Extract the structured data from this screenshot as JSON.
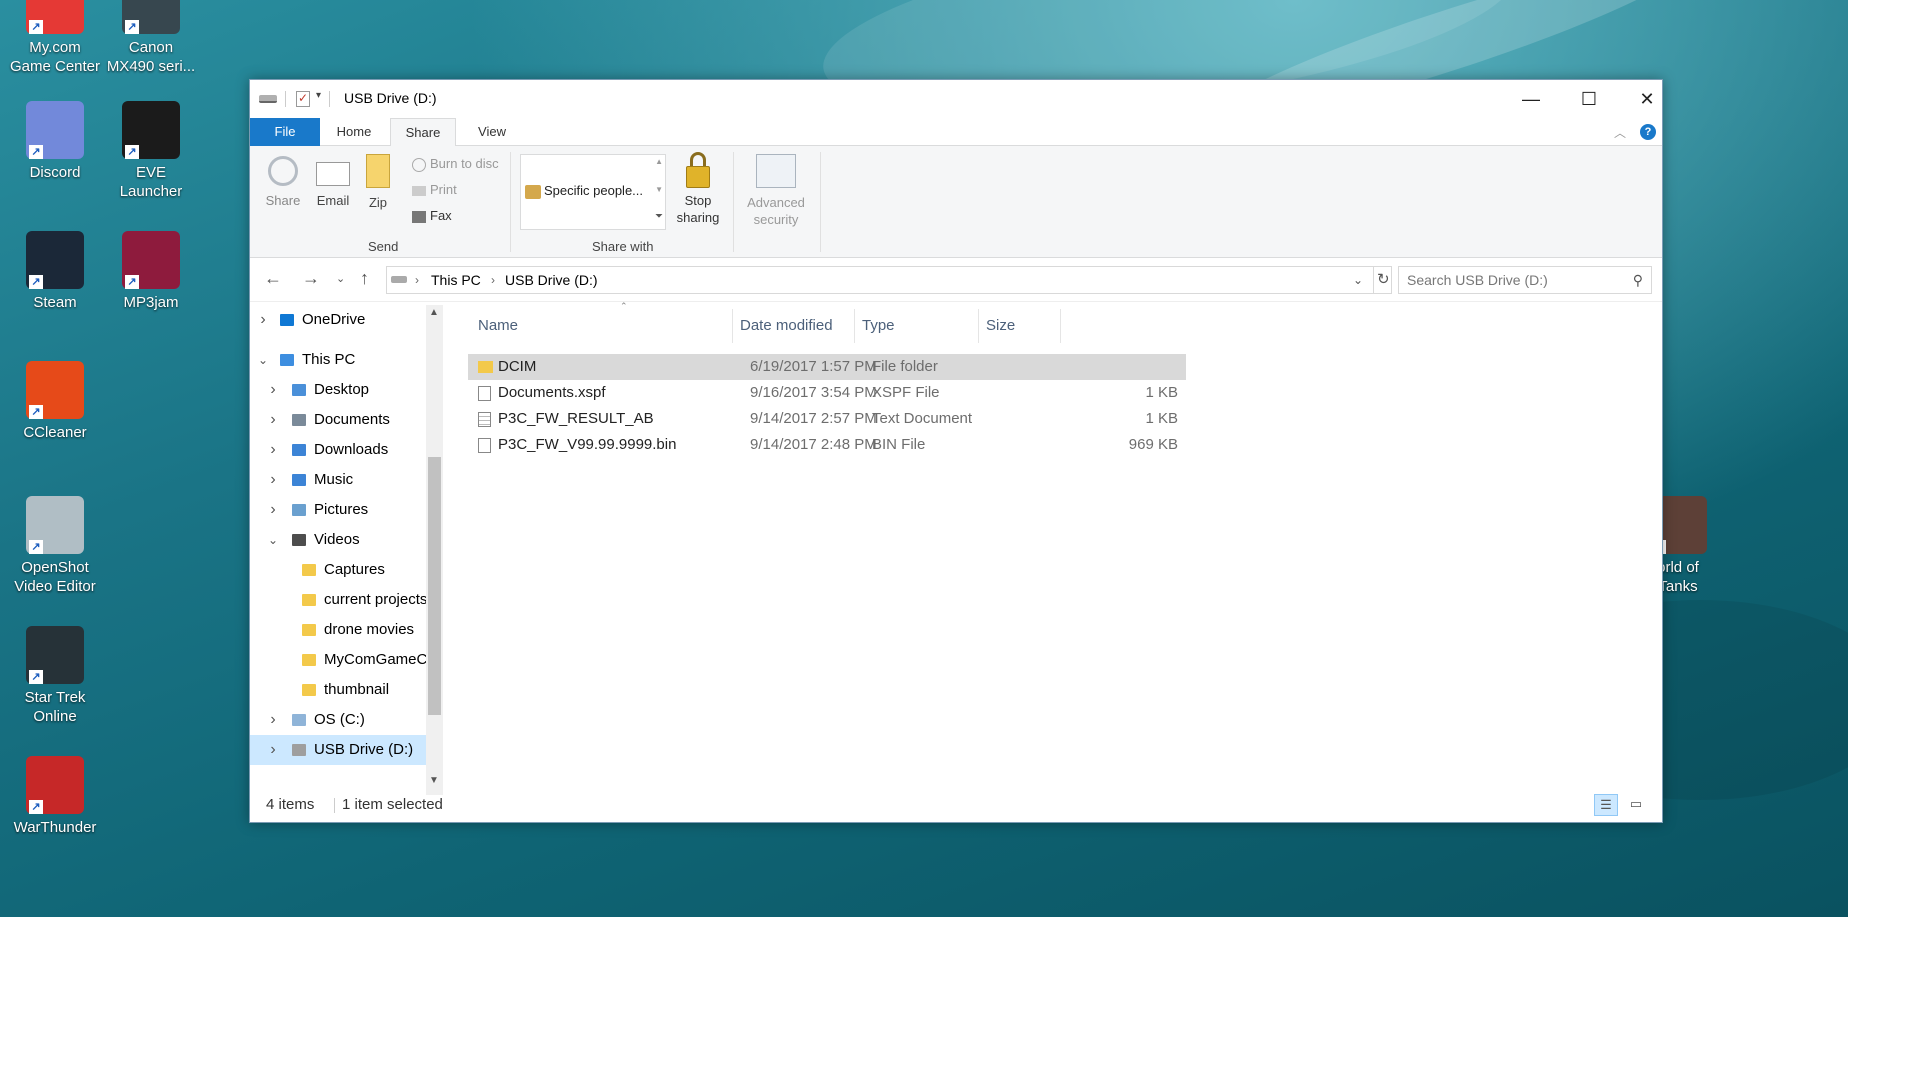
{
  "desktop": {
    "icons": [
      {
        "label": "My.com\nGame Center",
        "icon": "mycom-icon",
        "color": "#e53935"
      },
      {
        "label": "Canon\nMX490 seri...",
        "icon": "printer-icon",
        "color": "#37474f"
      },
      {
        "label": "Discord",
        "icon": "discord-icon",
        "color": "#7289da"
      },
      {
        "label": "EVE Launcher",
        "icon": "eve-icon",
        "color": "#1b1b1b"
      },
      {
        "label": "Steam",
        "icon": "steam-icon",
        "color": "#1b2838"
      },
      {
        "label": "MP3jam",
        "icon": "mp3jam-icon",
        "color": "#8e1b3d"
      },
      {
        "label": "CCleaner",
        "icon": "ccleaner-icon",
        "color": "#e64a19"
      },
      {
        "label": "OpenShot\nVideo Editor",
        "icon": "openshot-icon",
        "color": "#b0bec5"
      },
      {
        "label": "Star Trek\nOnline",
        "icon": "startrek-icon",
        "color": "#263238"
      },
      {
        "label": "WarThunder",
        "icon": "warthunder-icon",
        "color": "#c62828"
      },
      {
        "label": "orld of\nTanks",
        "icon": "worldoftanks-icon",
        "color": "#5d4037"
      }
    ]
  },
  "window": {
    "title": "USB Drive (D:)",
    "controls": {
      "minimize": "—",
      "maximize": "☐",
      "close": "✕"
    },
    "tabs": [
      "File",
      "Home",
      "Share",
      "View"
    ],
    "active_tab": "Share",
    "help": "?",
    "ribbon": {
      "send": {
        "share": "Share",
        "email": "Email",
        "zip": "Zip",
        "burn": "Burn to disc",
        "print": "Print",
        "fax": "Fax",
        "group_label": "Send"
      },
      "share_with": {
        "item": "Specific people...",
        "group_label": "Share with"
      },
      "stop_sharing": "Stop\nsharing",
      "advanced_security": "Advanced\nsecurity"
    },
    "address": {
      "crumbs": [
        "This PC",
        "USB Drive (D:)"
      ],
      "search_placeholder": "Search USB Drive (D:)"
    },
    "nav": [
      {
        "label": "OneDrive",
        "level": 0,
        "expand": "collapsed",
        "icon": "onedrive-icon",
        "color": "#0f78d4"
      },
      {
        "label": "This PC",
        "level": 0,
        "expand": "expanded",
        "icon": "pc-icon",
        "color": "#3d8ee0"
      },
      {
        "label": "Desktop",
        "level": 1,
        "expand": "collapsed",
        "icon": "desktop-folder-icon",
        "color": "#4a90d9"
      },
      {
        "label": "Documents",
        "level": 1,
        "expand": "collapsed",
        "icon": "documents-folder-icon",
        "color": "#7a8a99"
      },
      {
        "label": "Downloads",
        "level": 1,
        "expand": "collapsed",
        "icon": "downloads-folder-icon",
        "color": "#3c84d6"
      },
      {
        "label": "Music",
        "level": 1,
        "expand": "collapsed",
        "icon": "music-folder-icon",
        "color": "#3c84d6"
      },
      {
        "label": "Pictures",
        "level": 1,
        "expand": "collapsed",
        "icon": "pictures-folder-icon",
        "color": "#6aa0cf"
      },
      {
        "label": "Videos",
        "level": 1,
        "expand": "expanded",
        "icon": "videos-folder-icon",
        "color": "#4d4d4d"
      },
      {
        "label": "Captures",
        "level": 2,
        "expand": "none",
        "icon": "folder-icon",
        "color": "#f3c94a"
      },
      {
        "label": "current projects",
        "level": 2,
        "expand": "none",
        "icon": "folder-icon",
        "color": "#f3c94a"
      },
      {
        "label": "drone movies",
        "level": 2,
        "expand": "none",
        "icon": "folder-icon",
        "color": "#f3c94a"
      },
      {
        "label": "MyComGameCenter",
        "level": 2,
        "expand": "none",
        "icon": "folder-icon",
        "color": "#f3c94a"
      },
      {
        "label": "thumbnail",
        "level": 2,
        "expand": "none",
        "icon": "folder-icon",
        "color": "#f3c94a"
      },
      {
        "label": "OS (C:)",
        "level": 1,
        "expand": "collapsed",
        "icon": "drive-c-icon",
        "color": "#8fb4d8"
      },
      {
        "label": "USB Drive (D:)",
        "level": 1,
        "expand": "collapsed",
        "icon": "usb-drive-icon",
        "color": "#9e9e9e",
        "selected": true
      }
    ],
    "columns": [
      "Name",
      "Date modified",
      "Type",
      "Size"
    ],
    "files": [
      {
        "name": "DCIM",
        "date": "6/19/2017 1:57 PM",
        "type": "File folder",
        "size": "",
        "kind": "folder",
        "selected": true
      },
      {
        "name": "Documents.xspf",
        "date": "9/16/2017 3:54 PM",
        "type": "XSPF File",
        "size": "1 KB",
        "kind": "file"
      },
      {
        "name": "P3C_FW_RESULT_AB",
        "date": "9/14/2017 2:57 PM",
        "type": "Text Document",
        "size": "1 KB",
        "kind": "text"
      },
      {
        "name": "P3C_FW_V99.99.9999.bin",
        "date": "9/14/2017 2:48 PM",
        "type": "BIN File",
        "size": "969 KB",
        "kind": "file"
      }
    ],
    "status": {
      "items": "4 items",
      "selected": "1 item selected"
    },
    "colors": {
      "selection": "#d9d9d9",
      "nav_selected": "#cce8ff",
      "file_tab": "#1979ca",
      "accent": "#0078d7"
    }
  }
}
